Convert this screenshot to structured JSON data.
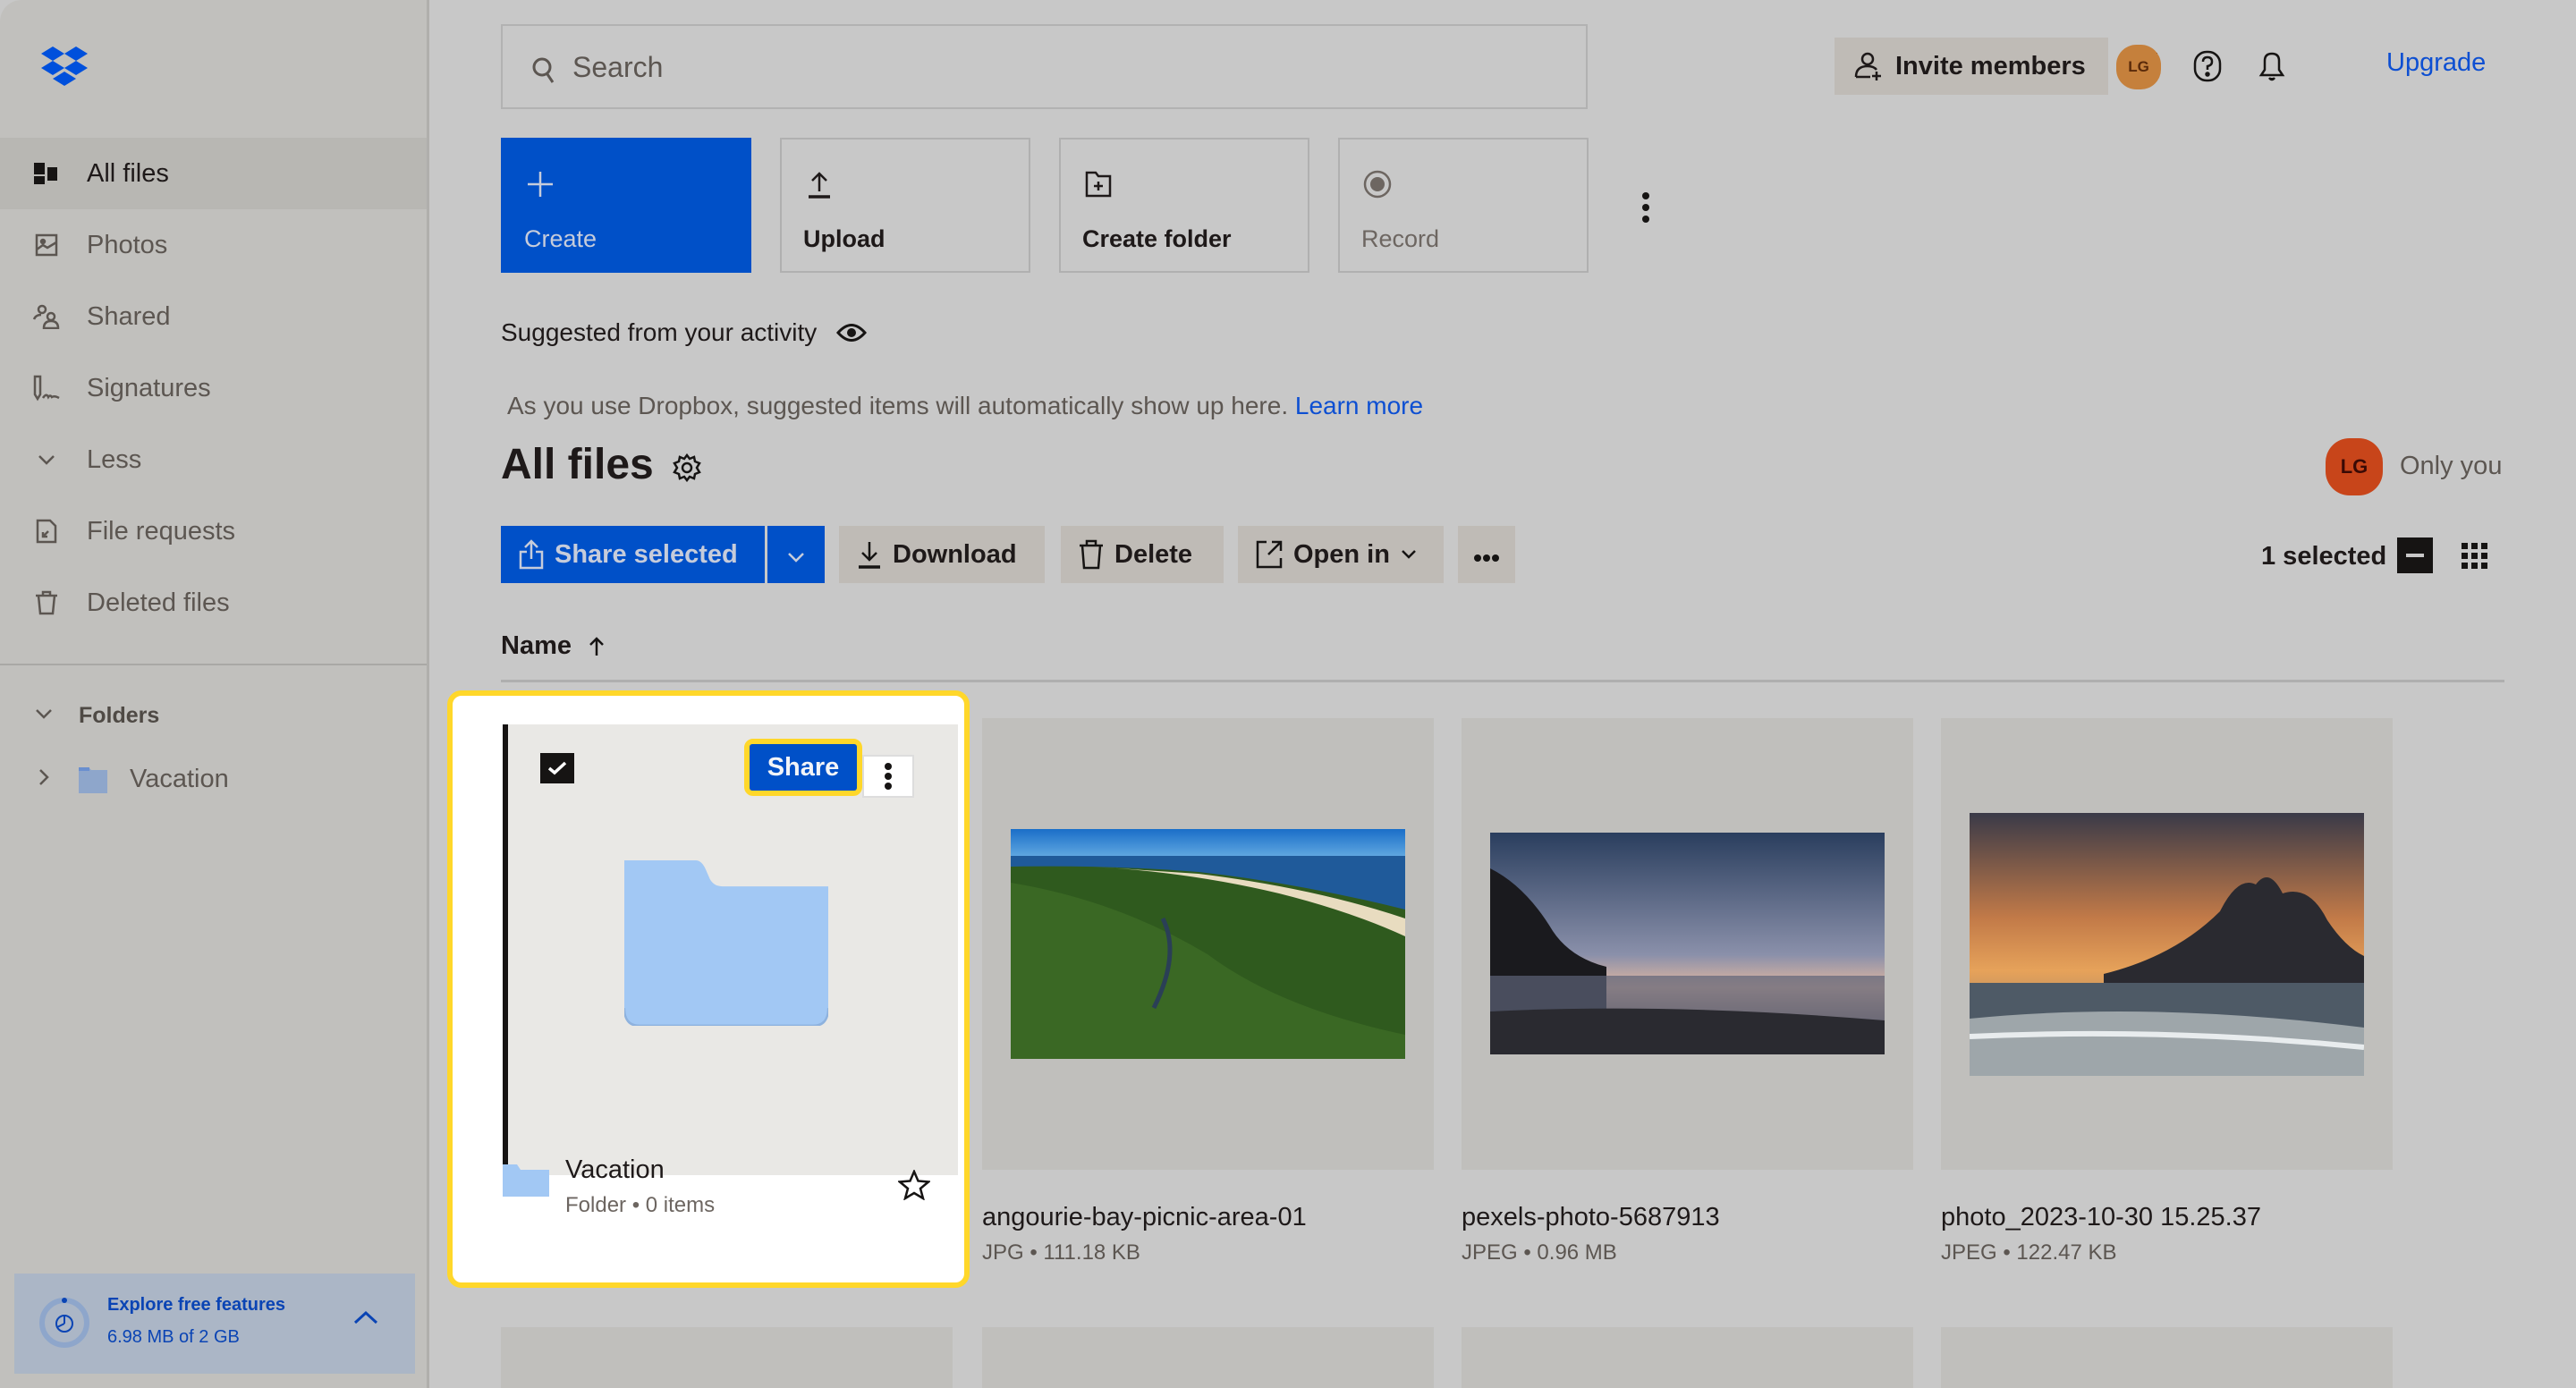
{
  "sidebar": {
    "logo": "dropbox-logo",
    "items": [
      {
        "label": "All files",
        "icon": "all-files-icon",
        "active": true
      },
      {
        "label": "Photos",
        "icon": "photo-icon"
      },
      {
        "label": "Shared",
        "icon": "shared-icon"
      },
      {
        "label": "Signatures",
        "icon": "signature-icon"
      },
      {
        "label": "Less",
        "icon": "chevron-down-icon"
      },
      {
        "label": "File requests",
        "icon": "file-request-icon"
      },
      {
        "label": "Deleted files",
        "icon": "trash-icon"
      }
    ],
    "folders_heading": "Folders",
    "folders": [
      {
        "label": "Vacation"
      }
    ],
    "explore": {
      "title": "Explore free features",
      "usage": "6.98 MB of 2 GB",
      "usage_fraction": 0.0034
    }
  },
  "header": {
    "search_placeholder": "Search",
    "invite_label": "Invite members",
    "avatar_initials": "LG",
    "upgrade_label": "Upgrade"
  },
  "actions": {
    "create": "Create",
    "upload": "Upload",
    "create_folder": "Create folder",
    "record": "Record"
  },
  "suggested": {
    "heading": "Suggested from your activity",
    "hint": "As you use Dropbox, suggested items will automatically show up here.",
    "learn_more": "Learn more"
  },
  "main": {
    "title": "All files",
    "owner_initials": "LG",
    "owner_label": "Only you",
    "toolbar": {
      "share_selected": "Share selected",
      "download": "Download",
      "delete": "Delete",
      "open_in": "Open in",
      "selected_count": "1 selected"
    },
    "sort_column": "Name",
    "share_button": "Share",
    "files": [
      {
        "name": "Vacation",
        "meta": "Folder • 0 items",
        "type": "folder",
        "selected": true
      },
      {
        "name": "angourie-bay-picnic-area-01",
        "meta": "JPG • 111.18 KB",
        "type": "image"
      },
      {
        "name": "pexels-photo-5687913",
        "meta": "JPEG • 0.96 MB",
        "type": "image"
      },
      {
        "name": "photo_2023-10-30 15.25.37",
        "meta": "JPEG • 122.47 KB",
        "type": "image"
      }
    ]
  },
  "colors": {
    "accent": "#0050c8",
    "highlight": "#ffd72a",
    "link": "#0d4fd2",
    "avatar_header": "#c5803c",
    "avatar_owner": "#c8451a"
  }
}
